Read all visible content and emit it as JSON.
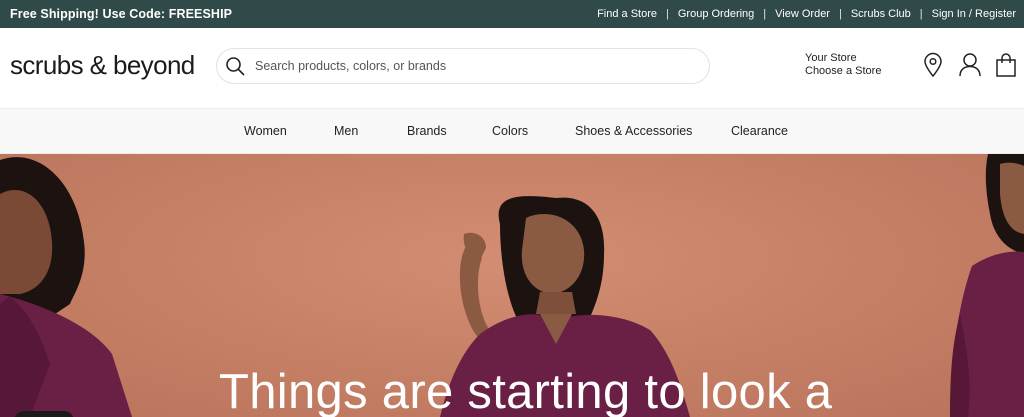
{
  "topbar": {
    "promo": "Free Shipping! Use Code: FREESHIP",
    "links": [
      "Find a Store",
      "Group Ordering",
      "View Order",
      "Scrubs Club",
      "Sign In / Register"
    ],
    "separator": "|"
  },
  "header": {
    "logo": "scrubs & beyond",
    "search_placeholder": "Search products, colors, or brands",
    "store_line1": "Your Store",
    "store_line2": "Choose a Store",
    "icons": [
      "location-pin-icon",
      "account-icon",
      "shopping-bag-icon"
    ]
  },
  "nav": {
    "items": [
      "Women",
      "Men",
      "Brands",
      "Colors",
      "Shoes & Accessories",
      "Clearance"
    ]
  },
  "hero": {
    "headline": "Things are starting to look a"
  },
  "colors": {
    "topbar_bg": "#2f4a48",
    "hero_bg": "#c78166",
    "scrub_purple": "#6a1f45",
    "nav_bg": "#f8f8f8"
  }
}
